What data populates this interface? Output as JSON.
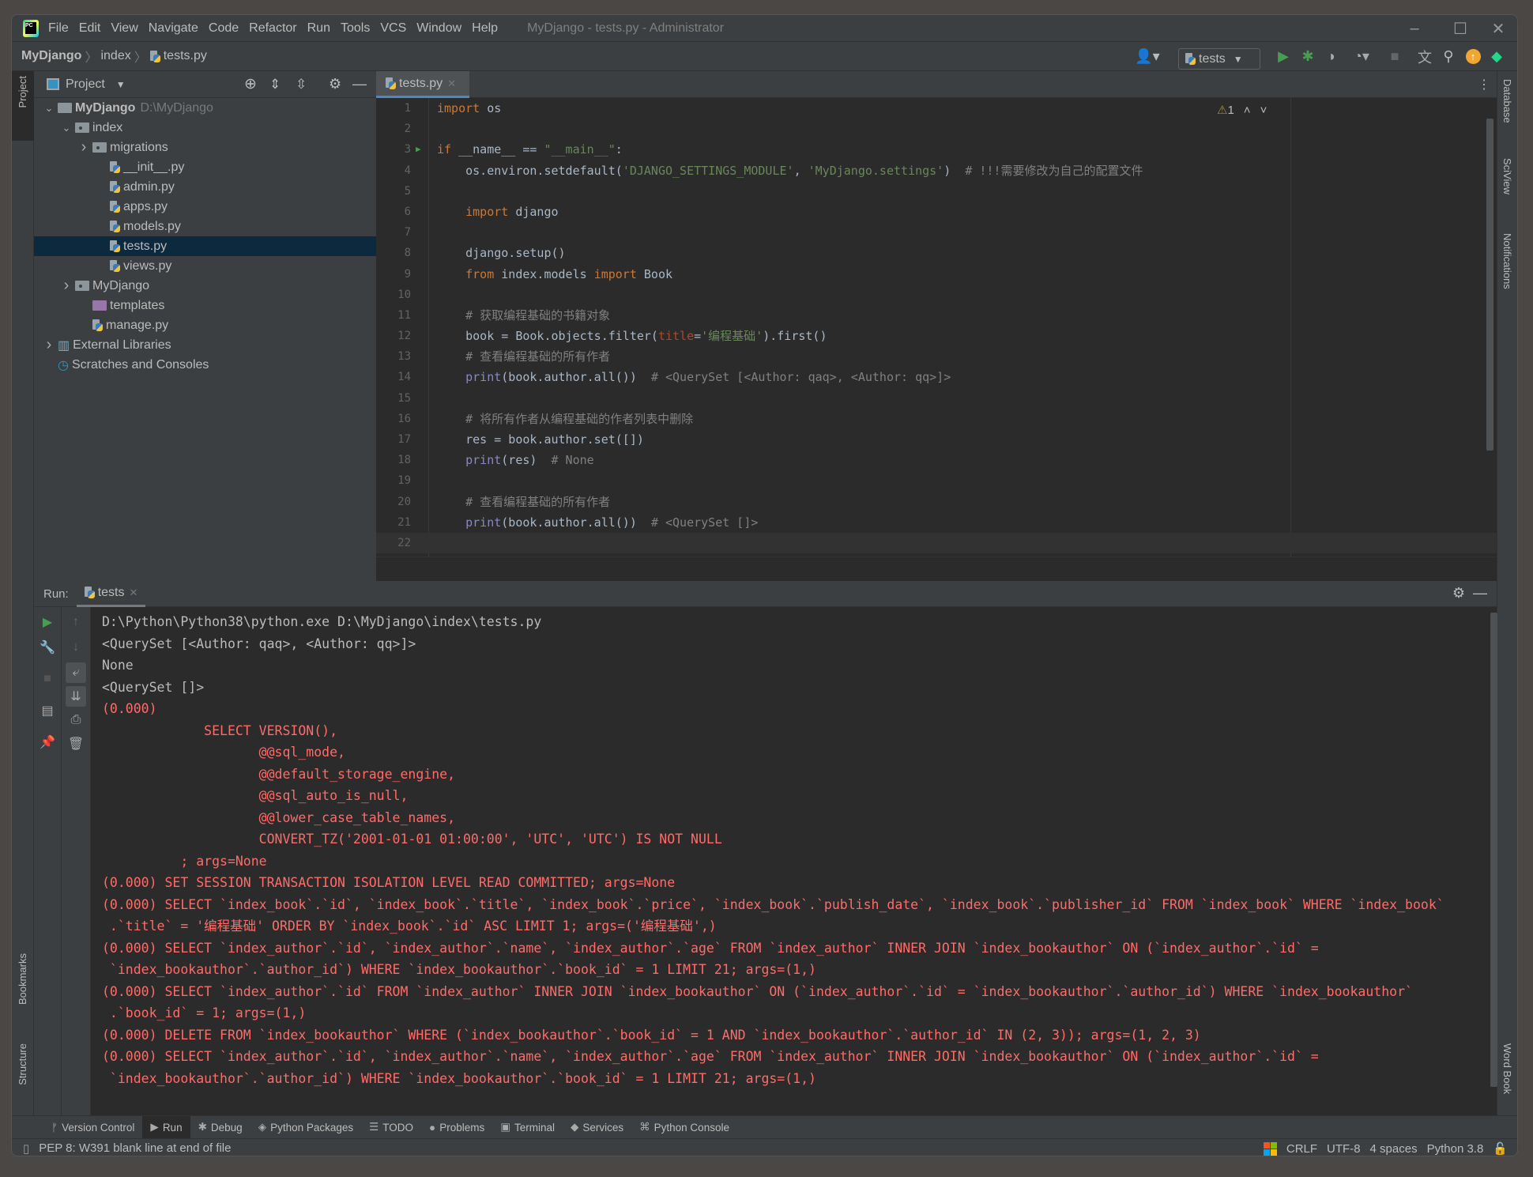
{
  "window": {
    "title": "MyDjango - tests.py - Administrator"
  },
  "menu": [
    "File",
    "Edit",
    "View",
    "Navigate",
    "Code",
    "Refactor",
    "Run",
    "Tools",
    "VCS",
    "Window",
    "Help"
  ],
  "breadcrumb": [
    "MyDjango",
    "index",
    "tests.py"
  ],
  "toolbar": {
    "run_config": "tests",
    "icons": [
      "user-icon",
      "run-icon",
      "debug-icon",
      "coverage-icon",
      "profile-icon",
      "stop-icon",
      "translate-icon",
      "search-icon",
      "update-icon",
      "jetbrains-icon"
    ]
  },
  "left_stripe": {
    "top": "Project",
    "bookmarks": "Bookmarks",
    "structure": "Structure"
  },
  "right_stripe": [
    "Database",
    "SciView",
    "Notifications",
    "Word Book"
  ],
  "project_panel": {
    "title": "Project",
    "tree": [
      {
        "label": "MyDjango",
        "hint": "D:\\MyDjango",
        "depth": 0,
        "arrow": "down",
        "icon": "folder",
        "bold": true
      },
      {
        "label": "index",
        "depth": 1,
        "arrow": "down",
        "icon": "module"
      },
      {
        "label": "migrations",
        "depth": 2,
        "arrow": "right",
        "icon": "module"
      },
      {
        "label": "__init__.py",
        "depth": 3,
        "icon": "python"
      },
      {
        "label": "admin.py",
        "depth": 3,
        "icon": "python"
      },
      {
        "label": "apps.py",
        "depth": 3,
        "icon": "python"
      },
      {
        "label": "models.py",
        "depth": 3,
        "icon": "python"
      },
      {
        "label": "tests.py",
        "depth": 3,
        "icon": "python",
        "selected": true
      },
      {
        "label": "views.py",
        "depth": 3,
        "icon": "python"
      },
      {
        "label": "MyDjango",
        "depth": 1,
        "arrow": "right",
        "icon": "module"
      },
      {
        "label": "templates",
        "depth": 2,
        "icon": "template-folder"
      },
      {
        "label": "manage.py",
        "depth": 2,
        "icon": "python"
      },
      {
        "label": "External Libraries",
        "depth": 0,
        "arrow": "right",
        "icon": "libraries"
      },
      {
        "label": "Scratches and Consoles",
        "depth": 0,
        "icon": "scratches"
      }
    ]
  },
  "editor": {
    "tab": "tests.py",
    "warnings": "1",
    "current_line": 22,
    "lines": [
      [
        [
          "kw",
          "import"
        ],
        [
          "nm",
          " os"
        ]
      ],
      [],
      [
        [
          "kw",
          "if"
        ],
        [
          "nm",
          " __name__ == "
        ],
        [
          "str",
          "\"__main__\""
        ],
        [
          "nm",
          ":"
        ]
      ],
      [
        [
          "nm",
          "    os.environ.setdefault("
        ],
        [
          "str",
          "'DJANGO_SETTINGS_MODULE'"
        ],
        [
          "nm",
          ", "
        ],
        [
          "str",
          "'MyDjango.settings'"
        ],
        [
          "nm",
          ")  "
        ],
        [
          "cm",
          "# !!!需要修改为自己的配置文件"
        ]
      ],
      [],
      [
        [
          "kw",
          "    import"
        ],
        [
          "nm",
          " django"
        ]
      ],
      [],
      [
        [
          "nm",
          "    django.setup()"
        ]
      ],
      [
        [
          "kw",
          "    from"
        ],
        [
          "nm",
          " index.models "
        ],
        [
          "kw",
          "import"
        ],
        [
          "nm",
          " Book"
        ]
      ],
      [],
      [
        [
          "cm",
          "    # 获取编程基础的书籍对象"
        ]
      ],
      [
        [
          "nm",
          "    book = Book.objects.filter("
        ],
        [
          "kwa",
          "title"
        ],
        [
          "nm",
          "="
        ],
        [
          "str",
          "'编程基础'"
        ],
        [
          "nm",
          ").first()"
        ]
      ],
      [
        [
          "cm",
          "    # 查看编程基础的所有作者"
        ]
      ],
      [
        [
          "bi",
          "    print"
        ],
        [
          "nm",
          "(book.author.all())  "
        ],
        [
          "cm",
          "# <QuerySet [<Author: qaq>, <Author: qq>]>"
        ]
      ],
      [],
      [
        [
          "cm",
          "    # 将所有作者从编程基础的作者列表中删除"
        ]
      ],
      [
        [
          "nm",
          "    res = book.author.set([])"
        ]
      ],
      [
        [
          "bi",
          "    print"
        ],
        [
          "nm",
          "(res)  "
        ],
        [
          "cm",
          "# None"
        ]
      ],
      [],
      [
        [
          "cm",
          "    # 查看编程基础的所有作者"
        ]
      ],
      [
        [
          "bi",
          "    print"
        ],
        [
          "nm",
          "(book.author.all())  "
        ],
        [
          "cm",
          "# <QuerySet []>"
        ]
      ],
      []
    ]
  },
  "run_panel": {
    "label": "Run:",
    "tab": "tests",
    "console": [
      {
        "text": "D:\\Python\\Python38\\python.exe D:\\MyDjango\\index\\tests.py",
        "type": "out"
      },
      {
        "text": "<QuerySet [<Author: qaq>, <Author: qq>]>",
        "type": "out"
      },
      {
        "text": "None",
        "type": "out"
      },
      {
        "text": "<QuerySet []>",
        "type": "out"
      },
      {
        "text": "(0.000)",
        "type": "err"
      },
      {
        "text": "             SELECT VERSION(),",
        "type": "err"
      },
      {
        "text": "                    @@sql_mode,",
        "type": "err"
      },
      {
        "text": "                    @@default_storage_engine,",
        "type": "err"
      },
      {
        "text": "                    @@sql_auto_is_null,",
        "type": "err"
      },
      {
        "text": "                    @@lower_case_table_names,",
        "type": "err"
      },
      {
        "text": "                    CONVERT_TZ('2001-01-01 01:00:00', 'UTC', 'UTC') IS NOT NULL",
        "type": "err"
      },
      {
        "text": "          ; args=None",
        "type": "err"
      },
      {
        "text": "(0.000) SET SESSION TRANSACTION ISOLATION LEVEL READ COMMITTED; args=None",
        "type": "err"
      },
      {
        "text": "(0.000) SELECT `index_book`.`id`, `index_book`.`title`, `index_book`.`price`, `index_book`.`publish_date`, `index_book`.`publisher_id` FROM `index_book` WHERE `index_book`",
        "type": "err"
      },
      {
        "text": " .`title` = '编程基础' ORDER BY `index_book`.`id` ASC LIMIT 1; args=('编程基础',)",
        "type": "err"
      },
      {
        "text": "(0.000) SELECT `index_author`.`id`, `index_author`.`name`, `index_author`.`age` FROM `index_author` INNER JOIN `index_bookauthor` ON (`index_author`.`id` =",
        "type": "err"
      },
      {
        "text": " `index_bookauthor`.`author_id`) WHERE `index_bookauthor`.`book_id` = 1 LIMIT 21; args=(1,)",
        "type": "err"
      },
      {
        "text": "(0.000) SELECT `index_author`.`id` FROM `index_author` INNER JOIN `index_bookauthor` ON (`index_author`.`id` = `index_bookauthor`.`author_id`) WHERE `index_bookauthor`",
        "type": "err"
      },
      {
        "text": " .`book_id` = 1; args=(1,)",
        "type": "err"
      },
      {
        "text": "(0.000) DELETE FROM `index_bookauthor` WHERE (`index_bookauthor`.`book_id` = 1 AND `index_bookauthor`.`author_id` IN (2, 3)); args=(1, 2, 3)",
        "type": "err"
      },
      {
        "text": "(0.000) SELECT `index_author`.`id`, `index_author`.`name`, `index_author`.`age` FROM `index_author` INNER JOIN `index_bookauthor` ON (`index_author`.`id` =",
        "type": "err"
      },
      {
        "text": " `index_bookauthor`.`author_id`) WHERE `index_bookauthor`.`book_id` = 1 LIMIT 21; args=(1,)",
        "type": "err"
      }
    ]
  },
  "bottom_tools": [
    {
      "label": "Version Control",
      "icon": "version-control-icon",
      "glyph": "ᚠ"
    },
    {
      "label": "Run",
      "icon": "run-icon",
      "glyph": "▶",
      "active": true
    },
    {
      "label": "Debug",
      "icon": "debug-icon",
      "glyph": "✱"
    },
    {
      "label": "Python Packages",
      "icon": "packages-icon",
      "glyph": "◈"
    },
    {
      "label": "TODO",
      "icon": "todo-icon",
      "glyph": "☰"
    },
    {
      "label": "Problems",
      "icon": "problems-icon",
      "glyph": "●"
    },
    {
      "label": "Terminal",
      "icon": "terminal-icon",
      "glyph": "▣"
    },
    {
      "label": "Services",
      "icon": "services-icon",
      "glyph": "◆"
    },
    {
      "label": "Python Console",
      "icon": "python-console-icon",
      "glyph": "⌘"
    }
  ],
  "status_bar": {
    "message": "PEP 8: W391 blank line at end of file",
    "line_separator": "CRLF",
    "encoding": "UTF-8",
    "indent": "4 spaces",
    "interpreter": "Python 3.8"
  },
  "colors": {
    "accent": "#4a88c7",
    "error_output": "#ff6b68",
    "keyword": "#cc7832",
    "string": "#6a8759",
    "comment": "#808080",
    "selection": "#0d293e",
    "run_green": "#499c54"
  }
}
